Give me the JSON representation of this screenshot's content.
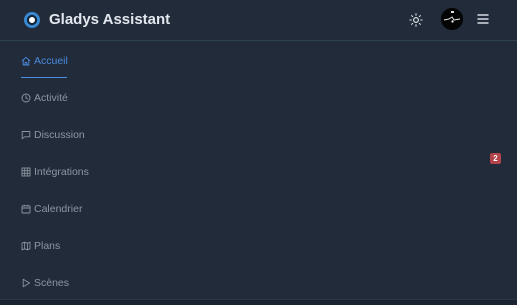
{
  "header": {
    "app_title": "Gladys Assistant",
    "logo_icon": "gladys-logo-icon",
    "theme_icon": "sun-icon",
    "avatar_icon": "avatar",
    "menu_icon": "hamburger-menu-icon"
  },
  "nav": {
    "items": [
      {
        "label": "Accueil",
        "icon": "home-icon",
        "active": true
      },
      {
        "label": "Activité",
        "icon": "clock-icon",
        "active": false
      },
      {
        "label": "Discussion",
        "icon": "chat-bubble-icon",
        "active": false
      },
      {
        "label": "Intégrations",
        "icon": "grid-icon",
        "active": false
      },
      {
        "label": "Calendrier",
        "icon": "calendar-icon",
        "active": false
      },
      {
        "label": "Plans",
        "icon": "map-icon",
        "active": false
      },
      {
        "label": "Scènes",
        "icon": "play-icon",
        "active": false
      }
    ]
  },
  "badge": {
    "count": "2"
  },
  "colors": {
    "background": "#212b3a",
    "active": "#4c8be0",
    "inactive": "#8f96a2",
    "title": "#e3e8ef",
    "badge": "#b2434a"
  }
}
